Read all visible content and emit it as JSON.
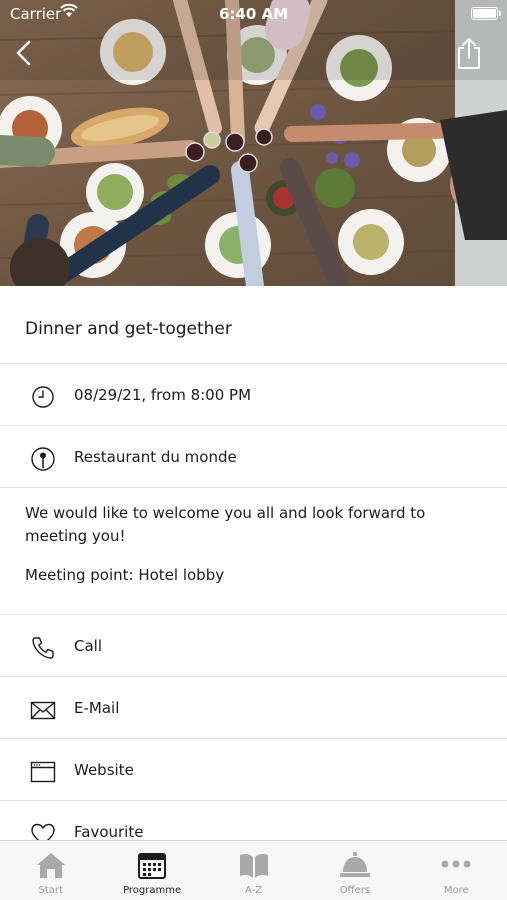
{
  "status_bar": {
    "carrier": "Carrier",
    "time": "6:40 AM"
  },
  "event": {
    "title": "Dinner and get-together",
    "datetime": "08/29/21, from 8:00 PM",
    "location": "Restaurant du monde",
    "description": [
      "We would like to welcome you all and look forward to meeting you!",
      "Meeting point: Hotel lobby"
    ]
  },
  "actions": {
    "call": "Call",
    "email": "E-Mail",
    "website": "Website",
    "favourite": "Favourite"
  },
  "tabs": [
    {
      "label": "Start",
      "icon": "home-icon"
    },
    {
      "label": "Programme",
      "icon": "calendar-icon",
      "active": true
    },
    {
      "label": "A-Z",
      "icon": "book-icon"
    },
    {
      "label": "Offers",
      "icon": "service-bell-icon"
    },
    {
      "label": "More",
      "icon": "more-dots-icon"
    }
  ],
  "colors": {
    "active_tab": "#1c1c1c",
    "inactive_tab": "#9a9a9a",
    "divider": "#e3e3e3"
  }
}
